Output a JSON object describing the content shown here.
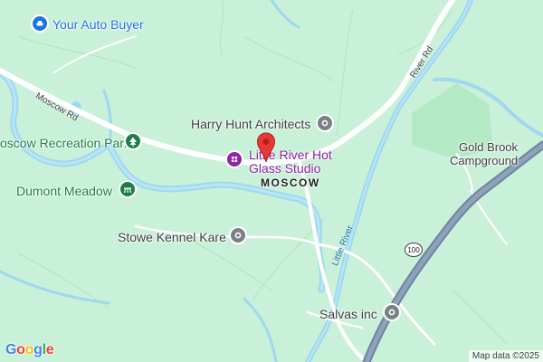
{
  "map": {
    "town": "MOSCOW",
    "roads": {
      "moscow_rd": "Moscow Rd",
      "river_rd": "River Rd",
      "route": "100"
    },
    "river": "Little River",
    "places": {
      "your_auto_buyer": "Your Auto Buyer",
      "harry_hunt": "Harry Hunt Architects",
      "recreation_park": "oscow Recreation Park",
      "hot_glass_line1": "Little River Hot",
      "hot_glass_line2": "Glass Studio",
      "dumont_meadow": "Dumont Meadow",
      "kennel": "Stowe Kennel Kare",
      "gold_brook_line1": "Gold Brook",
      "gold_brook_line2": "Campground",
      "salvas": "Salvas inc"
    },
    "attribution": "Map data ©2025",
    "logo": {
      "letters": [
        "G",
        "o",
        "o",
        "g",
        "l",
        "e"
      ]
    },
    "colors": {
      "land": "#c9f0d8",
      "water": "#9fd8f0",
      "water_edge": "#67c3e8",
      "road": "#ffffff",
      "highway": "#6f84a0",
      "marker": "#e53935",
      "poi_purple": "#8e24aa",
      "poi_blue": "#1a73e8",
      "poi_green": "#1e7e4a",
      "poi_gray": "#7a8086"
    }
  }
}
